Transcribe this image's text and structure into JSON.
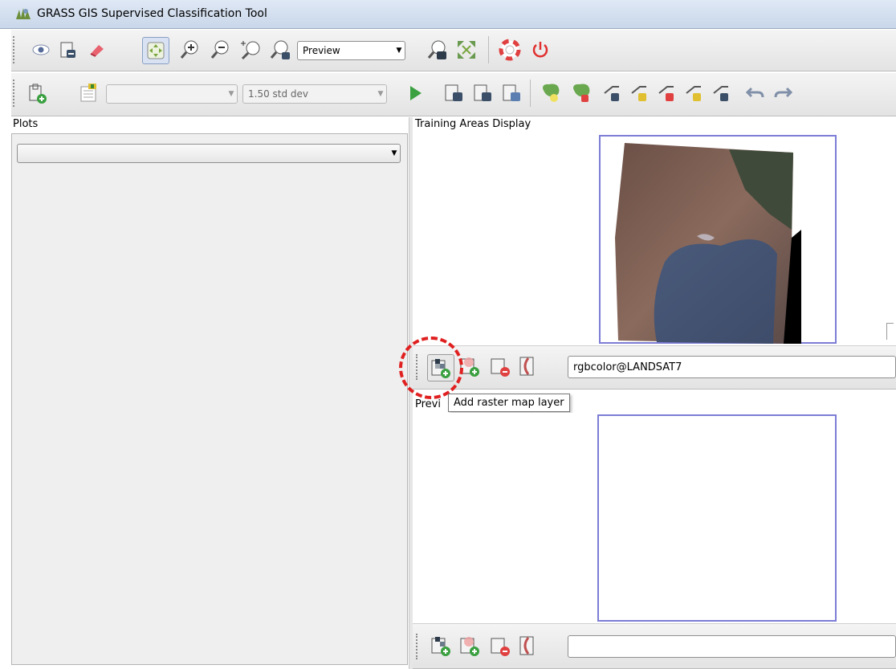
{
  "window": {
    "title": "GRASS GIS Supervised Classification Tool"
  },
  "toolbar1": {
    "icons": [
      "eye-icon",
      "add-layer-icon",
      "eraser-icon",
      "pan-icon",
      "zoom-in-icon",
      "zoom-out-icon",
      "zoom-box-icon",
      "zoom-extent-icon",
      "zoom-back-icon",
      "zoom-region-icon",
      "help-icon",
      "quit-icon"
    ],
    "display_mode": "Preview"
  },
  "toolbar2": {
    "class_select": "",
    "std_dev": "1.50 std dev",
    "icons": [
      "select-group-icon",
      "class-manager-icon",
      "run-icon",
      "import-areas-icon",
      "export-areas-icon",
      "export-signatures-icon",
      "add-area-icon",
      "delete-area-icon",
      "add-line-icon",
      "add-vertex-icon",
      "delete-vertex-icon",
      "edit-line-icon",
      "move-line-icon",
      "undo-icon",
      "redo-icon"
    ]
  },
  "plots": {
    "label": "Plots",
    "selected": ""
  },
  "training": {
    "label": "Training Areas Display"
  },
  "preview": {
    "label": "Previ"
  },
  "layer_toolbar": {
    "selected_layer": "rgbcolor@LANDSAT7",
    "tooltip": "Add raster map layer"
  },
  "bottom_toolbar": {
    "selected_layer": ""
  },
  "colors": {
    "frame": "#7d7dd6",
    "highlight": "#e02020",
    "accent": "#4caf50"
  }
}
